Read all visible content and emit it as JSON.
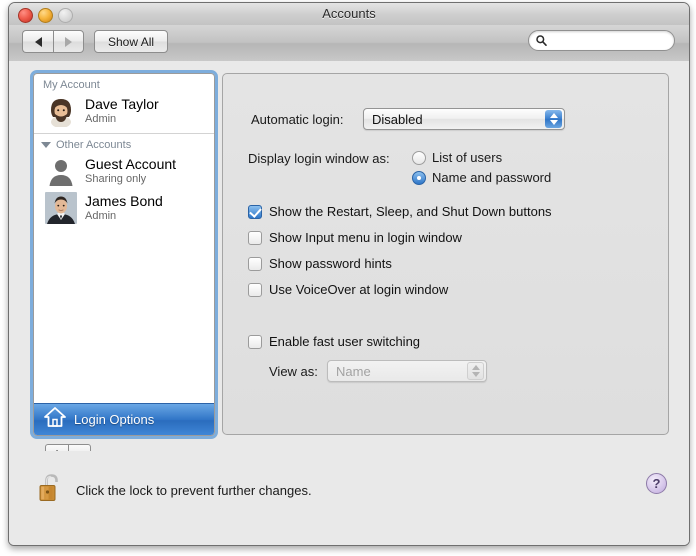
{
  "window": {
    "title": "Accounts",
    "traffic_lights": [
      "close",
      "minimize",
      "zoom"
    ]
  },
  "toolbar": {
    "back_icon": "back-arrow-icon",
    "forward_icon": "forward-arrow-icon",
    "show_all_label": "Show All",
    "search_placeholder": "",
    "search_value": "",
    "search_icon": "magnifier-icon"
  },
  "sidebar": {
    "groups": [
      {
        "header": "My Account",
        "has_disclosure": false,
        "accounts": [
          {
            "name": "Dave Taylor",
            "role": "Admin",
            "avatar": "photo-bearded-man"
          }
        ]
      },
      {
        "header": "Other Accounts",
        "has_disclosure": true,
        "disclosure_icon": "triangle-down-icon",
        "accounts": [
          {
            "name": "Guest Account",
            "role": "Sharing only",
            "avatar": "generic-person-silhouette"
          },
          {
            "name": "James Bond",
            "role": "Admin",
            "avatar": "photo-man-in-suit"
          }
        ]
      }
    ],
    "login_options": {
      "label": "Login Options",
      "icon": "house-icon",
      "selected": true
    },
    "add_button_label": "+",
    "remove_button_label": "–"
  },
  "main": {
    "automatic_login": {
      "label": "Automatic login:",
      "value": "Disabled",
      "enabled": true
    },
    "display_login_window": {
      "label": "Display login window as:",
      "options": [
        {
          "label": "List of users",
          "selected": false
        },
        {
          "label": "Name and password",
          "selected": true
        }
      ]
    },
    "checkboxes": [
      {
        "label": "Show the Restart, Sleep, and Shut Down buttons",
        "checked": true
      },
      {
        "label": "Show Input menu in login window",
        "checked": false
      },
      {
        "label": "Show password hints",
        "checked": false
      },
      {
        "label": "Use VoiceOver at login window",
        "checked": false
      }
    ],
    "fast_switching": {
      "label": "Enable fast user switching",
      "checked": false,
      "view_as_label": "View as:",
      "view_as_value": "Name",
      "view_as_enabled": false
    }
  },
  "footer": {
    "lock_icon": "open-padlock-icon",
    "lock_text": "Click the lock to prevent further changes.",
    "help_label": "?"
  },
  "colors": {
    "selection_blue": "#2f74c6",
    "control_blue": "#2e76c8",
    "window_bg": "#e9e9e9",
    "panel_bg": "#e0e0e0",
    "lock_gold": "#d79b3e"
  }
}
